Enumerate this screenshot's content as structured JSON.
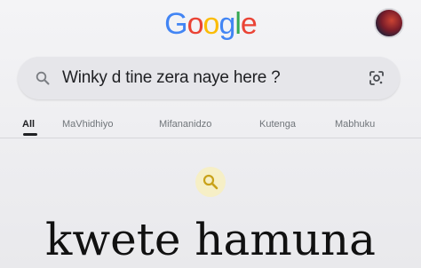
{
  "logo": {
    "letters": [
      "G",
      "o",
      "o",
      "g",
      "l",
      "e"
    ],
    "colors": [
      "#4285F4",
      "#EA4335",
      "#FBBC05",
      "#4285F4",
      "#34A853",
      "#EA4335"
    ]
  },
  "search": {
    "query": "Winky d tine zera naye  here ?",
    "icon": "search-icon",
    "lens_icon": "google-lens-icon"
  },
  "tabs": [
    {
      "label": "All",
      "active": true
    },
    {
      "label": "MaVhidhiyo",
      "active": false
    },
    {
      "label": "Mifananidzo",
      "active": false
    },
    {
      "label": "Kutenga",
      "active": false
    },
    {
      "label": "Mabhuku",
      "active": false
    }
  ],
  "result_icon": "search-icon",
  "caption": "kwete hamuna"
}
